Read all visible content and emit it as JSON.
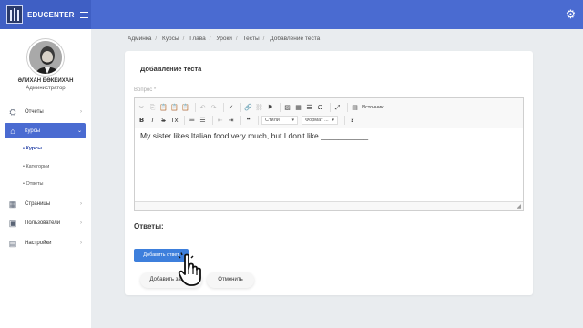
{
  "header": {
    "brand": "EDUCENTER",
    "icons": {
      "logo": "building-logo",
      "menu": "menu-icon",
      "settings": "gear-icon"
    }
  },
  "sidebar": {
    "user_name": "ӘЛИХАН БӨКЕЙХАН",
    "user_role": "Администратор",
    "items": [
      {
        "label": "Отчеты",
        "icon": "chart-icon"
      },
      {
        "label": "Курсы",
        "icon": "house-icon"
      },
      {
        "label": "Страницы",
        "icon": "pages-icon"
      },
      {
        "label": "Пользователи",
        "icon": "users-icon"
      },
      {
        "label": "Настройки",
        "icon": "settings-icon"
      }
    ],
    "subitems": [
      "Курсы",
      "Категории",
      "Ответы"
    ]
  },
  "breadcrumb": [
    "Админка",
    "Курсы",
    "Глава",
    "Уроки",
    "Тесты",
    "Добавление теста"
  ],
  "form": {
    "title": "Добавление теста",
    "question_label": "Вопрос *",
    "editor_text": "My sister likes Italian food very much, but I don't like ___________",
    "toolbar": {
      "styles_label": "Стили",
      "format_label": "Формат ...",
      "source_label": "Источник"
    },
    "answers_label": "Ответы:",
    "add_answer_button": "Добавить ответ",
    "add_record_button": "Добавить запись",
    "cancel_button": "Отменить"
  },
  "colors": {
    "primary": "#4a6bd1",
    "button": "#3d7fdc",
    "background": "#e9ecef"
  }
}
